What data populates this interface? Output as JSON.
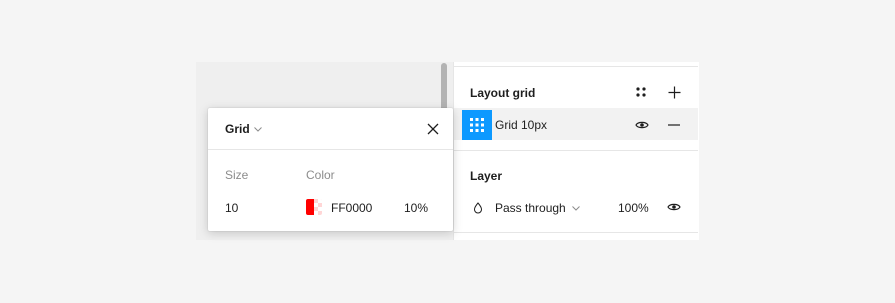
{
  "layout_grid": {
    "title": "Layout grid",
    "styles_icon": "grid-styles-icon",
    "add_icon": "plus-icon",
    "item": {
      "label": "Grid 10px",
      "icon": "layout-grid-icon",
      "visibility_icon": "eye-icon",
      "remove_icon": "minus-icon",
      "swatch_color": "#0d99ff"
    }
  },
  "layer": {
    "title": "Layer",
    "blend_icon": "blend-mode-icon",
    "blend_mode": "Pass through",
    "opacity": "100%",
    "visibility_icon": "eye-icon"
  },
  "popover": {
    "title": "Grid",
    "dropdown_icon": "chevron-down-icon",
    "close_icon": "close-icon",
    "size_label": "Size",
    "color_label": "Color",
    "size_value": "10",
    "color_hex": "FF0000",
    "color_swatch": "#ff0000",
    "color_opacity": "10%"
  }
}
